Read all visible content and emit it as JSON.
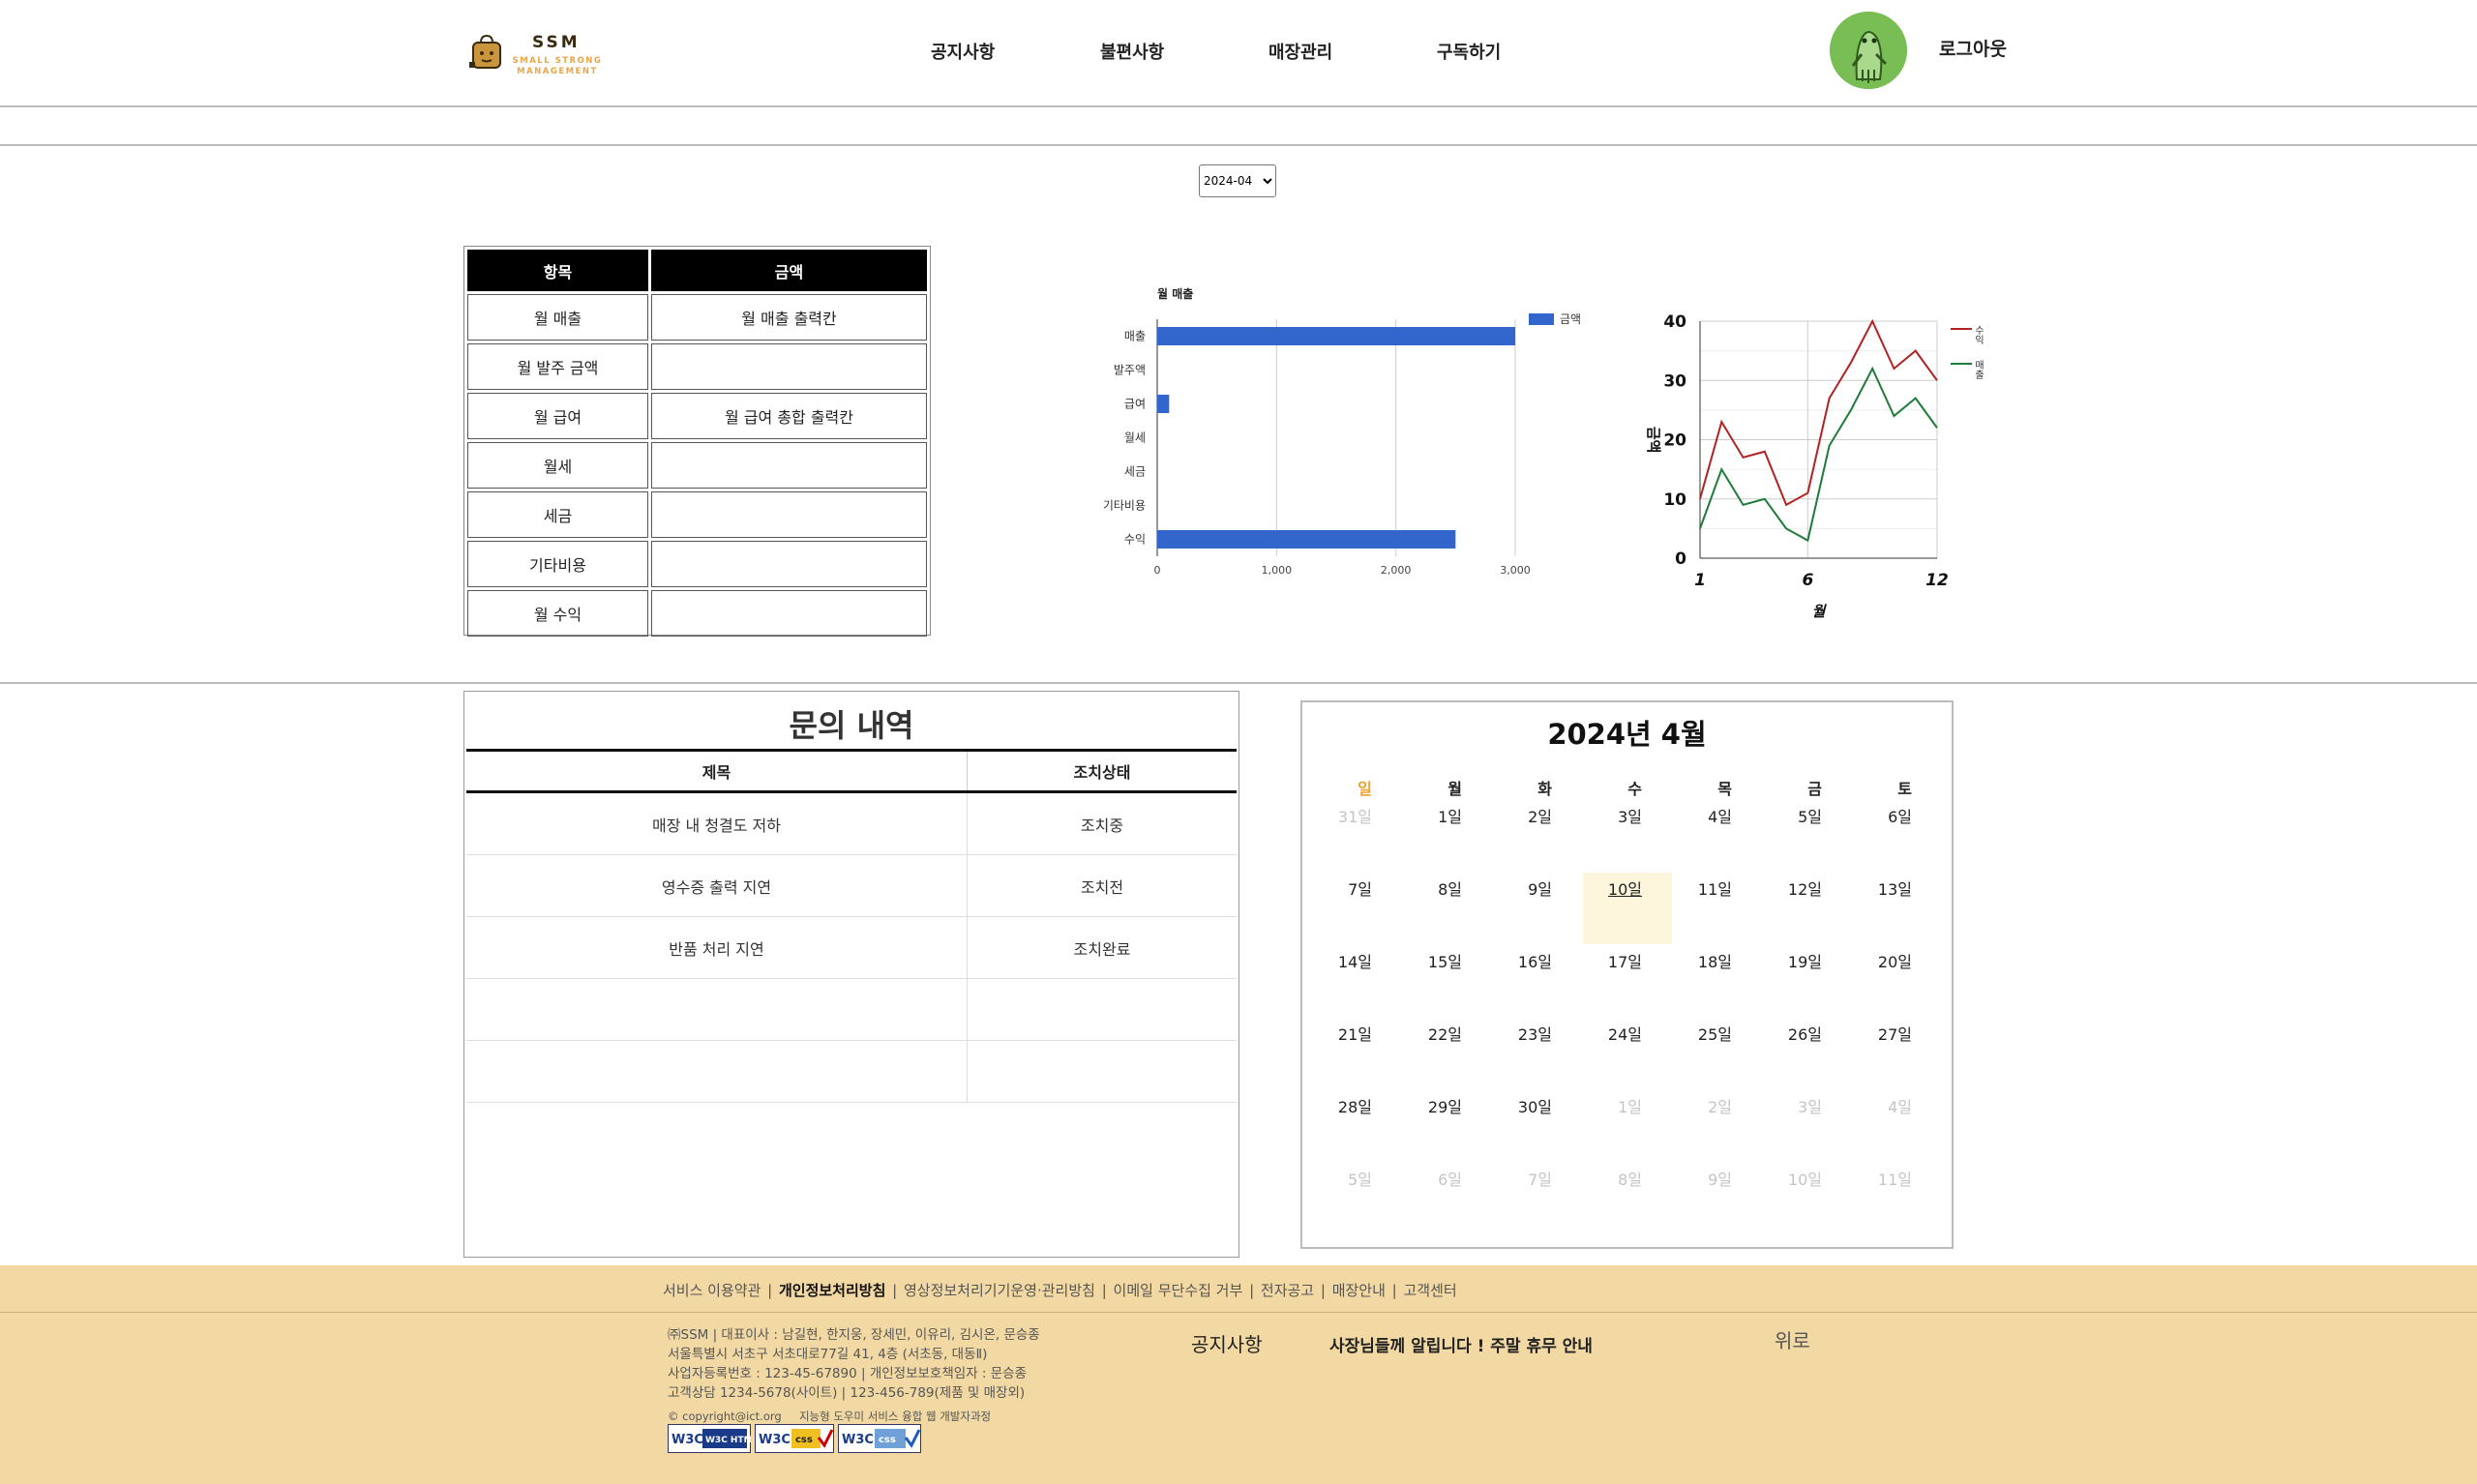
{
  "header": {
    "logo_name": "SSM",
    "logo_sub": "SMALL STRONG MANAGEMENT",
    "nav": [
      "공지사항",
      "불편사항",
      "매장관리",
      "구독하기"
    ],
    "logout": "로그아웃"
  },
  "month_select": {
    "value": "2024-04",
    "options": [
      "2024-04"
    ]
  },
  "expense_table": {
    "headers": [
      "항목",
      "금액"
    ],
    "rows": [
      [
        "월 매출",
        "월 매출 출력칸"
      ],
      [
        "월 발주 금액",
        ""
      ],
      [
        "월 급여",
        "월 급여 총합 출력칸"
      ],
      [
        "월세",
        ""
      ],
      [
        "세금",
        ""
      ],
      [
        "기타비용",
        ""
      ],
      [
        "월 수익",
        ""
      ]
    ]
  },
  "chart_data": [
    {
      "type": "bar",
      "orientation": "horizontal",
      "title": "월 매출",
      "categories": [
        "매출",
        "발주액",
        "급여",
        "월세",
        "세금",
        "기타비용",
        "수익"
      ],
      "series": [
        {
          "name": "금액",
          "values": [
            3000,
            0,
            100,
            0,
            0,
            0,
            2500
          ],
          "color": "#3366cc"
        }
      ],
      "xlim": [
        0,
        3000
      ],
      "xticks": [
        "0",
        "1,000",
        "2,000",
        "3,000"
      ],
      "grid": true,
      "legend": "right"
    },
    {
      "type": "line",
      "xlabel": "월",
      "ylabel": "금액",
      "x": [
        1,
        2,
        3,
        4,
        5,
        6,
        7,
        8,
        9,
        10,
        11,
        12
      ],
      "xticks": [
        "1",
        "6",
        "12"
      ],
      "yticks": [
        "0",
        "10",
        "20",
        "30",
        "40"
      ],
      "ylim": [
        0,
        40
      ],
      "series": [
        {
          "name": "수익",
          "color": "#b22222",
          "values": [
            10,
            23,
            17,
            18,
            9,
            11,
            27,
            33,
            40,
            32,
            35,
            30
          ]
        },
        {
          "name": "매출",
          "color": "#1e7b3a",
          "values": [
            5,
            15,
            9,
            10,
            5,
            3,
            19,
            25,
            32,
            24,
            27,
            22
          ]
        }
      ],
      "grid": true,
      "legend": "right"
    }
  ],
  "inquiry": {
    "title": "문의 내역",
    "headers": [
      "제목",
      "조치상태"
    ],
    "rows": [
      [
        "매장 내 청결도 저하",
        "조치중"
      ],
      [
        "영수증 출력 지연",
        "조치전"
      ],
      [
        "반품 처리 지연",
        "조치완료"
      ],
      [
        "",
        ""
      ],
      [
        "",
        ""
      ]
    ]
  },
  "calendar": {
    "title": "2024년 4월",
    "weekdays": [
      "일",
      "월",
      "화",
      "수",
      "목",
      "금",
      "토"
    ],
    "sunday_color": "#f0a030",
    "today": "10일",
    "weeks": [
      [
        "31일",
        "1일",
        "2일",
        "3일",
        "4일",
        "5일",
        "6일"
      ],
      [
        "7일",
        "8일",
        "9일",
        "10일",
        "11일",
        "12일",
        "13일"
      ],
      [
        "14일",
        "15일",
        "16일",
        "17일",
        "18일",
        "19일",
        "20일"
      ],
      [
        "21일",
        "22일",
        "23일",
        "24일",
        "25일",
        "26일",
        "27일"
      ],
      [
        "28일",
        "29일",
        "30일",
        "1일",
        "2일",
        "3일",
        "4일"
      ],
      [
        "5일",
        "6일",
        "7일",
        "8일",
        "9일",
        "10일",
        "11일"
      ]
    ],
    "muted": [
      [
        0,
        0
      ],
      [
        4,
        3
      ],
      [
        4,
        4
      ],
      [
        4,
        5
      ],
      [
        4,
        6
      ],
      [
        5,
        0
      ],
      [
        5,
        1
      ],
      [
        5,
        2
      ],
      [
        5,
        3
      ],
      [
        5,
        4
      ],
      [
        5,
        5
      ],
      [
        5,
        6
      ]
    ]
  },
  "footer": {
    "links": [
      "서비스 이용약관",
      "개인정보처리방침",
      "영상정보처리기기운영·관리방침",
      "이메일 무단수집 거부",
      "전자공고",
      "매장안내",
      "고객센터"
    ],
    "info_lines": [
      "㈜SSM | 대표이사 : 남길현, 한지웅, 장세민, 이유리, 김시온, 문승종",
      "서울특별시 서초구 서초대로77길 41, 4층 (서초동, 대동Ⅱ)",
      "사업자등록번호 : 123-45-67890 | 개인정보보호책임자 : 문승종",
      "고객상담 1234-5678(사이트) | 123-456-789(제품 및 매장외)"
    ],
    "copyright": "© copyright@ict.org     지능형 도우미 서비스 융합 웹 개발자과정",
    "notice_label": "공지사항",
    "notice_text": "사장님들께 알립니다 ! 주말 휴무 안내",
    "top_button": "위로",
    "badges": [
      "W3C HTML 5",
      "W3C CSS",
      "W3C CSS"
    ],
    "background": "#f2d8a3"
  }
}
